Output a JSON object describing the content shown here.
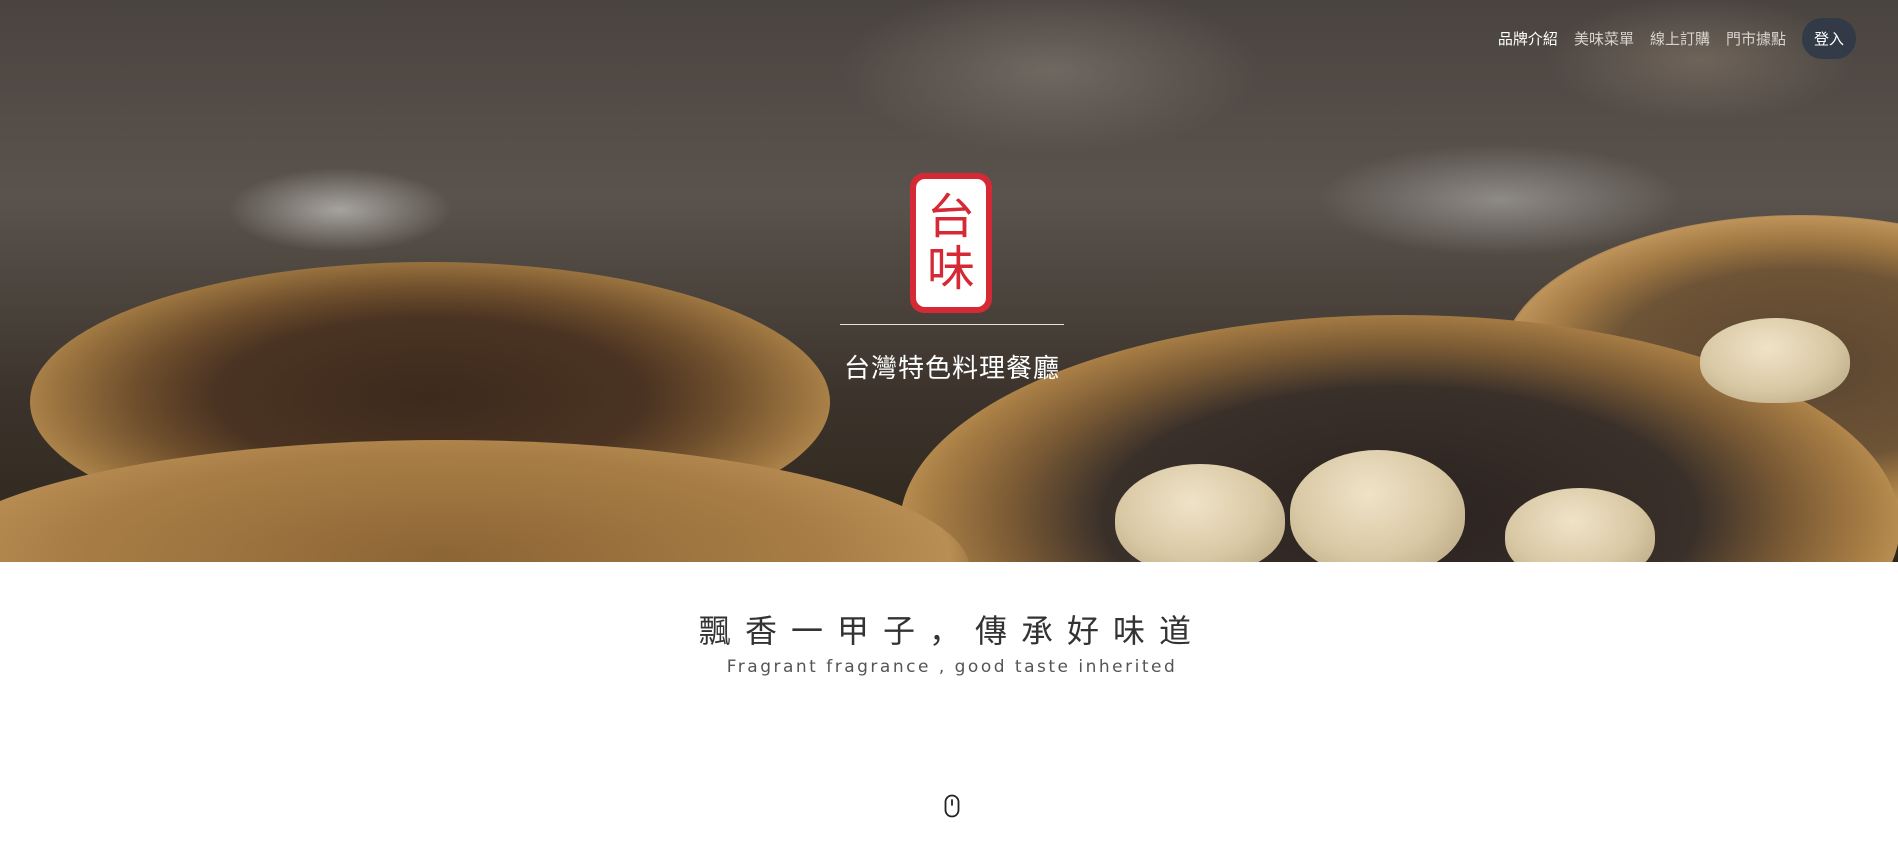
{
  "nav": {
    "items": [
      {
        "label": "品牌介紹",
        "active": true
      },
      {
        "label": "美味菜單",
        "active": false
      },
      {
        "label": "線上訂購",
        "active": false
      },
      {
        "label": "門市據點",
        "active": false
      }
    ],
    "login_label": "登入"
  },
  "hero": {
    "logo": {
      "chars": [
        "台",
        "味"
      ]
    },
    "subtitle": "台灣特色料理餐廳"
  },
  "intro": {
    "slogan": "飄香一甲子，傳承好味道",
    "slogan_en": "Fragrant fragrance , good taste inherited"
  },
  "scroll_indicator": {
    "icon": "mouse-scroll-icon"
  },
  "colors": {
    "brand_red": "#d52a36",
    "login_bg": "#303a48",
    "text_dark": "#333333"
  }
}
